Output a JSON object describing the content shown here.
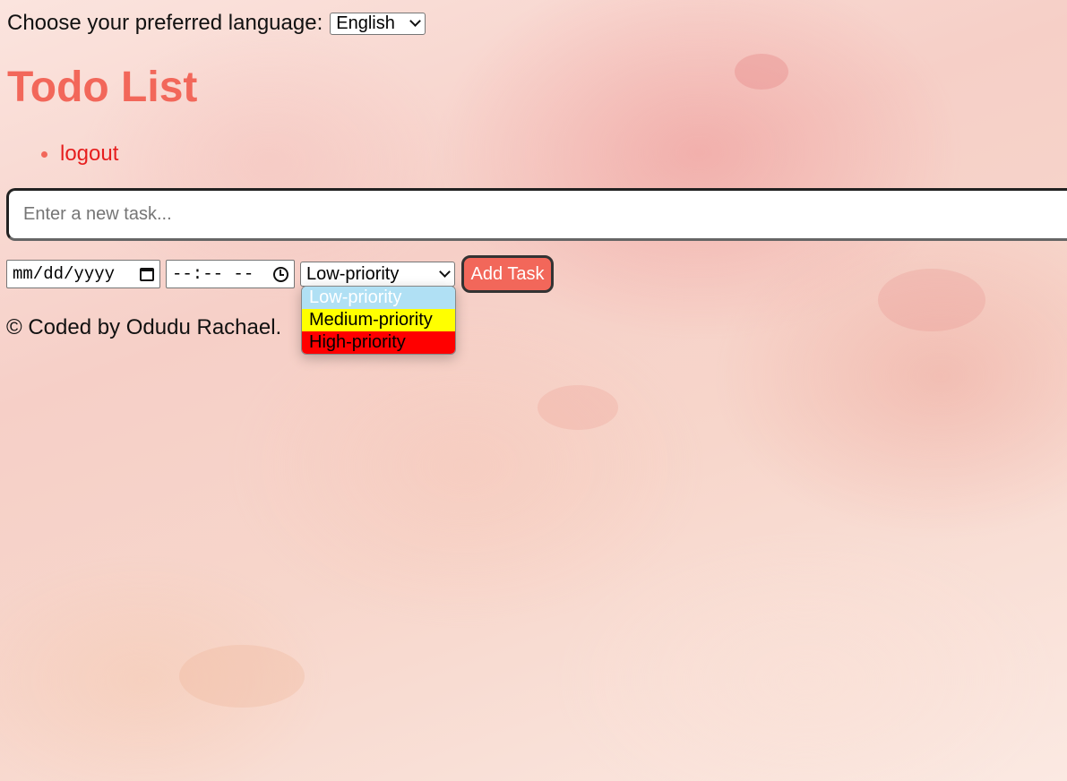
{
  "language": {
    "label": "Choose your preferred language:",
    "selected": "English"
  },
  "title": "Todo List",
  "nav": {
    "logout": "logout"
  },
  "task_input": {
    "placeholder": "Enter a new task..."
  },
  "date_input": {
    "placeholder": "mm/dd/yyyy"
  },
  "time_input": {
    "placeholder": "--:-- --"
  },
  "priority": {
    "selected": "Low-priority",
    "options": [
      {
        "label": "Low-priority",
        "bg": "#b0e0f4",
        "fg": "#ffffff"
      },
      {
        "label": "Medium-priority",
        "bg": "#ffff00",
        "fg": "#000000"
      },
      {
        "label": "High-priority",
        "bg": "#ff0000",
        "fg": "#000000"
      }
    ]
  },
  "add_button": "Add Task",
  "footer": "© Coded by Odudu Rachael.",
  "colors": {
    "accent": "#f2675a",
    "logout_link": "#e61e1e"
  }
}
